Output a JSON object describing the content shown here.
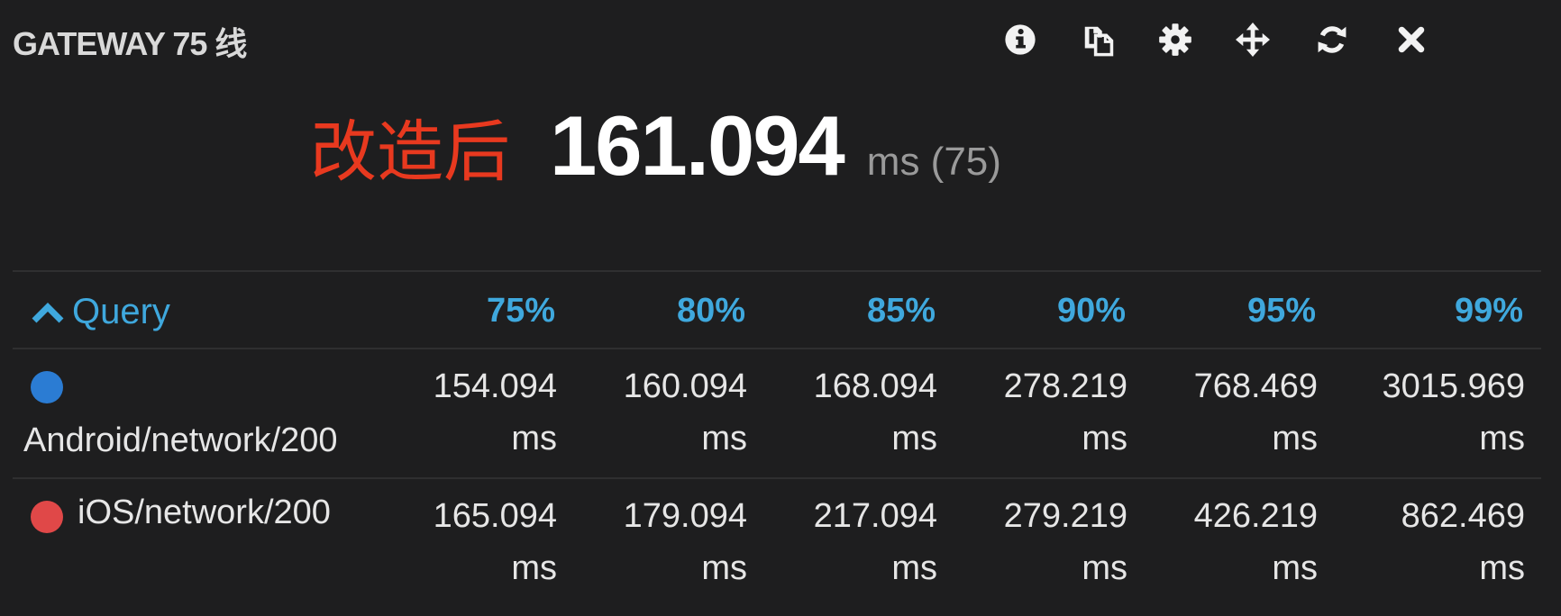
{
  "header": {
    "title": "GATEWAY 75 线",
    "tools": [
      {
        "icon": "info-icon"
      },
      {
        "icon": "copy-icon"
      },
      {
        "icon": "gear-icon"
      },
      {
        "icon": "move-icon"
      },
      {
        "icon": "refresh-icon"
      },
      {
        "icon": "close-icon"
      }
    ]
  },
  "stat": {
    "annotation": "改造后",
    "value": "161.094",
    "unit": "ms (75)"
  },
  "table": {
    "query_label": "Query",
    "columns": [
      "75%",
      "80%",
      "85%",
      "90%",
      "95%",
      "99%"
    ],
    "rows": [
      {
        "label": "Android/network/200",
        "color": "#2b7cd3",
        "values": [
          "154.094",
          "160.094",
          "168.094",
          "278.219",
          "768.469",
          "3015.969"
        ],
        "unit": "ms"
      },
      {
        "label": "iOS/network/200",
        "color": "#e04848",
        "values": [
          "165.094",
          "179.094",
          "217.094",
          "279.219",
          "426.219",
          "862.469"
        ],
        "unit": "ms"
      }
    ]
  },
  "colors": {
    "background": "#1e1e1f",
    "accent": "#3fa8dd",
    "annotation": "#e8391f"
  }
}
